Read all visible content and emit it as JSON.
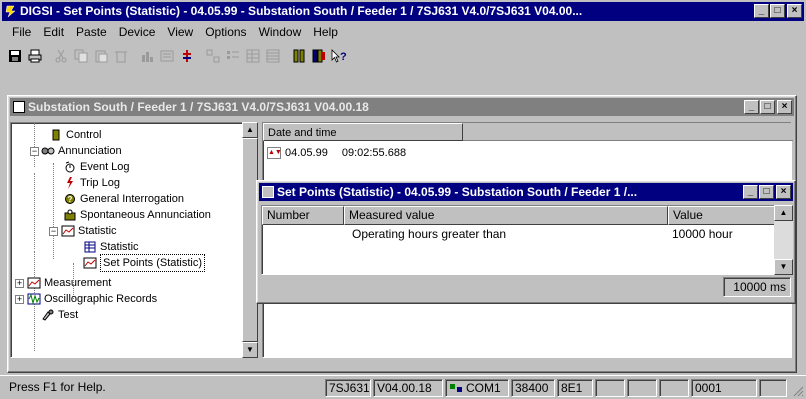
{
  "app": {
    "title": "DIGSI - Set Points (Statistic) - 04.05.99 - Substation South / Feeder 1 / 7SJ631 V4.0/7SJ631 V04.00...",
    "window_buttons": [
      "_",
      "□",
      "×"
    ]
  },
  "menu": [
    "File",
    "Edit",
    "Paste",
    "Device",
    "View",
    "Options",
    "Window",
    "Help"
  ],
  "toolbar": {
    "icons": [
      "save-icon",
      "print-icon",
      "cut-icon",
      "copy-icon",
      "paste-icon",
      "delete-icon",
      "bars-icon",
      "properties-icon",
      "chart-icon",
      "large-icons-icon",
      "small-icons-icon",
      "list-icon",
      "details-icon",
      "device-icon",
      "device2-icon",
      "help-pointer-icon"
    ]
  },
  "child_window": {
    "title": "Substation South / Feeder 1 / 7SJ631 V4.0/7SJ631 V04.00.18"
  },
  "tree": [
    {
      "label": "Control",
      "indent": 1,
      "icon": "control-icon"
    },
    {
      "label": "Annunciation",
      "indent": 0,
      "icon": "annunciation-icon",
      "expander": "−"
    },
    {
      "label": "Event Log",
      "indent": 2,
      "icon": "event-log-icon"
    },
    {
      "label": "Trip Log",
      "indent": 2,
      "icon": "trip-log-icon"
    },
    {
      "label": "General Interrogation",
      "indent": 2,
      "icon": "interrogation-icon"
    },
    {
      "label": "Spontaneous Annunciation",
      "indent": 2,
      "icon": "spontaneous-icon"
    },
    {
      "label": "Statistic",
      "indent": 1,
      "icon": "statistic-folder-icon",
      "expander": "−"
    },
    {
      "label": "Statistic",
      "indent": 3,
      "icon": "statistic-table-icon"
    },
    {
      "label": "Set Points (Statistic)",
      "indent": 3,
      "icon": "setpoints-icon",
      "selected": true
    },
    {
      "label": "Measurement",
      "indent": 0,
      "icon": "measurement-icon",
      "expander": "+"
    },
    {
      "label": "Oscillographic Records",
      "indent": 0,
      "icon": "oscillographic-icon",
      "expander": "+"
    },
    {
      "label": "Test",
      "indent": 1,
      "icon": "test-icon"
    }
  ],
  "list": {
    "header": "Date and time",
    "rows": [
      {
        "date": "04.05.99",
        "time": "09:02:55.688"
      }
    ]
  },
  "setpoints_window": {
    "title": "Set Points (Statistic) - 04.05.99 - Substation South / Feeder 1 /...",
    "columns": [
      "Number",
      "Measured value",
      "Value"
    ],
    "rows": [
      {
        "number": "",
        "measured": "Operating hours greater than",
        "value": "10000 hour"
      }
    ],
    "status": "10000 ms"
  },
  "statusbar": {
    "help": "Press F1 for Help.",
    "device": "7SJ631",
    "version": "V04.00.18",
    "port": "COM1",
    "baud": "38400",
    "format": "8E1",
    "counter": "0001"
  }
}
